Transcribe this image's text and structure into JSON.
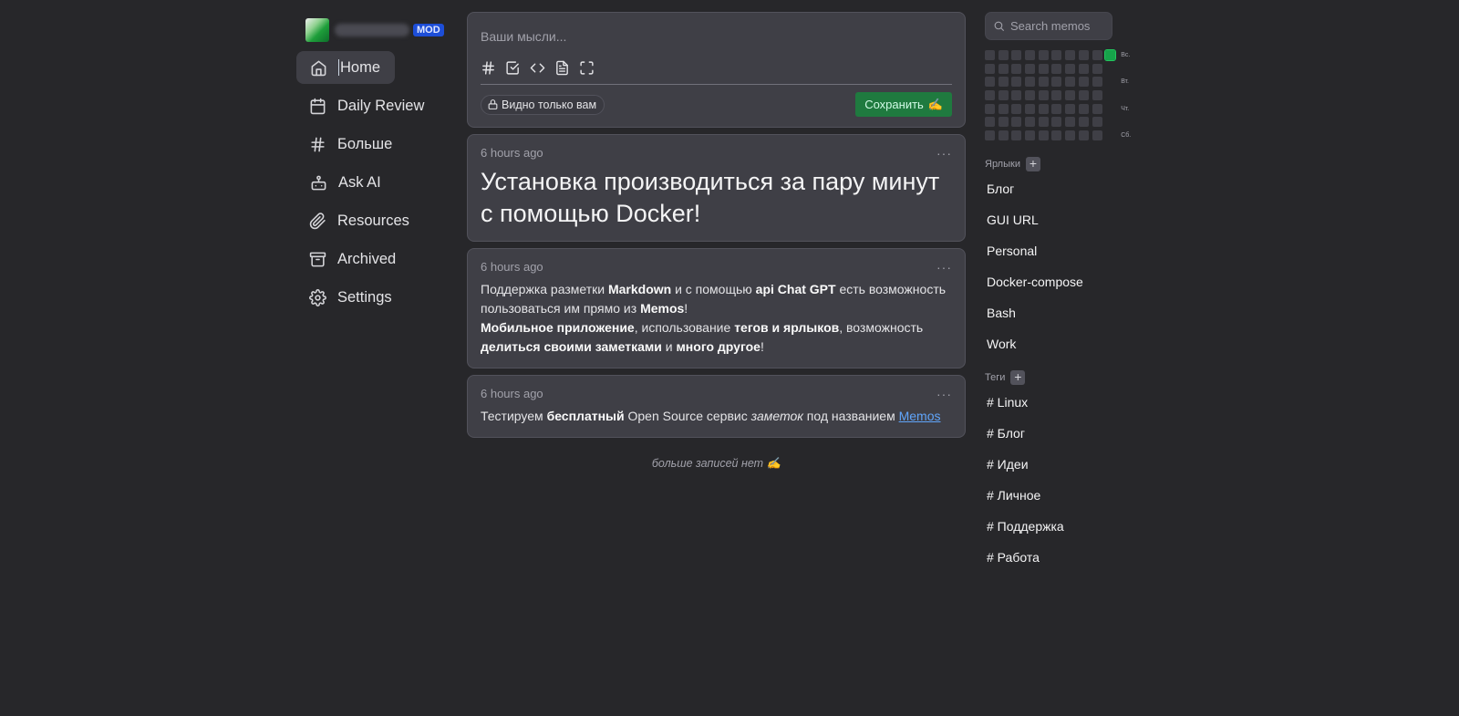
{
  "user": {
    "badge": "MOD"
  },
  "sidebar": {
    "items": [
      {
        "label": "Home",
        "icon": "home-icon",
        "active": true
      },
      {
        "label": "Daily Review",
        "icon": "calendar-icon"
      },
      {
        "label": "Больше",
        "icon": "hash-icon"
      },
      {
        "label": "Ask AI",
        "icon": "bot-icon"
      },
      {
        "label": "Resources",
        "icon": "paperclip-icon"
      },
      {
        "label": "Archived",
        "icon": "archive-icon"
      },
      {
        "label": "Settings",
        "icon": "gear-icon"
      }
    ]
  },
  "editor": {
    "placeholder": "Ваши мысли...",
    "tools": [
      "hash-icon",
      "checkbox-icon",
      "code-icon",
      "file-text-icon",
      "fullscreen-icon"
    ],
    "visibility_label": "Видно только вам",
    "save_label": "Сохранить",
    "save_emoji": "✍️"
  },
  "memos": [
    {
      "time": "6 hours ago",
      "heading": "Установка производиться за пару минут с помощью Docker!"
    },
    {
      "time": "6 hours ago",
      "p1": {
        "t1": "Поддержка разметки ",
        "b1": "Markdown",
        "t2": " и с помощью ",
        "b2": "api Chat GPT",
        "t3": " есть возможность пользоваться им прямо из ",
        "b3": "Memos",
        "t4": "!"
      },
      "p2": {
        "b1": "Мобильное приложение",
        "t1": ", использование ",
        "b2": "тегов и ярлыков",
        "t2": ", возможность ",
        "b3": "делиться своими заметками",
        "t3": " и ",
        "b4": "много другое",
        "t4": "!"
      }
    },
    {
      "time": "6 hours ago",
      "t1": "Тестируем ",
      "b1": "бесплатный",
      "t2": " Open Source сервис ",
      "i1": "заметок",
      "t3": " под названием ",
      "link": "Memos"
    }
  ],
  "memo_more_label": "···",
  "end_text": "больше записей нет",
  "end_emoji": "✍️",
  "search": {
    "placeholder": "Search memos"
  },
  "heatmap": {
    "weekday_labels": [
      "Вс.",
      "",
      "Вт.",
      "",
      "Чт.",
      "",
      "Сб."
    ],
    "columns": 10,
    "active_cells": [
      {
        "column": 9,
        "row": 0,
        "level": 1
      }
    ]
  },
  "shortcuts": {
    "title": "Ярлыки",
    "items": [
      "Блог",
      "GUI URL",
      "Personal",
      "Docker-compose",
      "Bash",
      "Work"
    ]
  },
  "tags": {
    "title": "Теги",
    "items": [
      "# Linux",
      "# Блог",
      "# Идеи",
      "# Личное",
      "# Поддержка",
      "# Работа"
    ]
  }
}
